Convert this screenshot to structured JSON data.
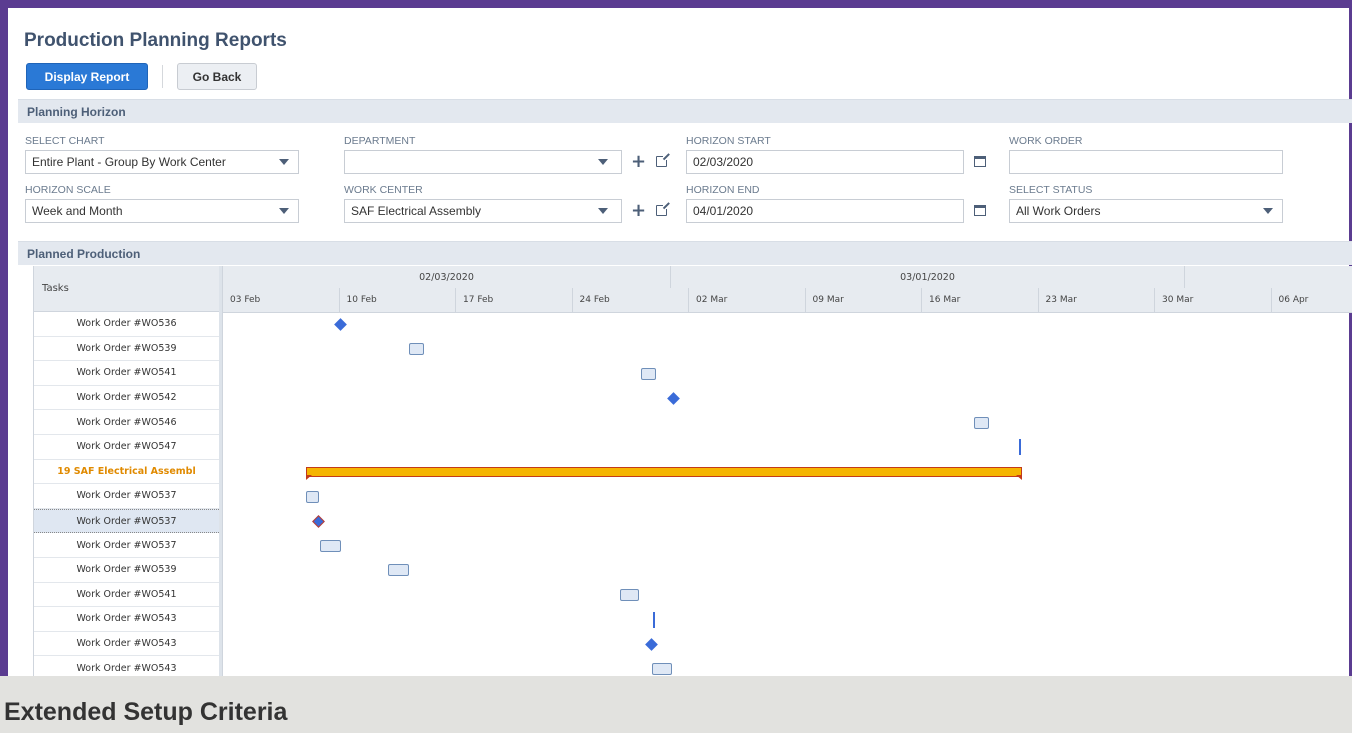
{
  "page": {
    "title": "Production Planning Reports",
    "display_report_label": "Display Report",
    "go_back_label": "Go Back"
  },
  "sections": {
    "planning_horizon": "Planning Horizon",
    "planned_production": "Planned Production"
  },
  "fields": {
    "select_chart": {
      "label": "SELECT CHART",
      "value": "Entire Plant - Group By Work Center"
    },
    "horizon_scale": {
      "label": "HORIZON SCALE",
      "value": "Week and Month"
    },
    "department": {
      "label": "DEPARTMENT",
      "value": ""
    },
    "work_center": {
      "label": "WORK CENTER",
      "value": "SAF Electrical Assembly"
    },
    "horizon_start": {
      "label": "HORIZON START",
      "value": "02/03/2020"
    },
    "horizon_end": {
      "label": "HORIZON END",
      "value": "04/01/2020"
    },
    "work_order": {
      "label": "WORK ORDER",
      "value": ""
    },
    "select_status": {
      "label": "SELECT STATUS",
      "value": "All Work Orders"
    }
  },
  "gantt": {
    "tasks_header": "Tasks",
    "months": [
      "02/03/2020",
      "03/01/2020",
      ""
    ],
    "weeks": [
      "03 Feb",
      "10 Feb",
      "17 Feb",
      "24 Feb",
      "02 Mar",
      "09 Mar",
      "16 Mar",
      "23 Mar",
      "30 Mar",
      "06 Apr"
    ],
    "tasks": [
      {
        "label": "Work Order #WO536"
      },
      {
        "label": "Work Order #WO539"
      },
      {
        "label": "Work Order #WO541"
      },
      {
        "label": "Work Order #WO542"
      },
      {
        "label": "Work Order #WO546"
      },
      {
        "label": "Work Order #WO547"
      },
      {
        "label": "19 SAF Electrical Assembl",
        "group": true
      },
      {
        "label": "Work Order #WO537"
      },
      {
        "label": "Work Order #WO537",
        "selected": true
      },
      {
        "label": "Work Order #WO537"
      },
      {
        "label": "Work Order #WO539"
      },
      {
        "label": "Work Order #WO541"
      },
      {
        "label": "Work Order #WO543"
      },
      {
        "label": "Work Order #WO543"
      },
      {
        "label": "Work Order #WO543"
      }
    ]
  },
  "footer": {
    "title": "Extended Setup Criteria"
  },
  "colors": {
    "frame": "#5b3c91",
    "primary_button": "#2a79d6",
    "milestone": "#3a6bd8",
    "group_bar": "#f5b400",
    "group_bar_border": "#c23a1a",
    "group_label": "#e08a00"
  }
}
